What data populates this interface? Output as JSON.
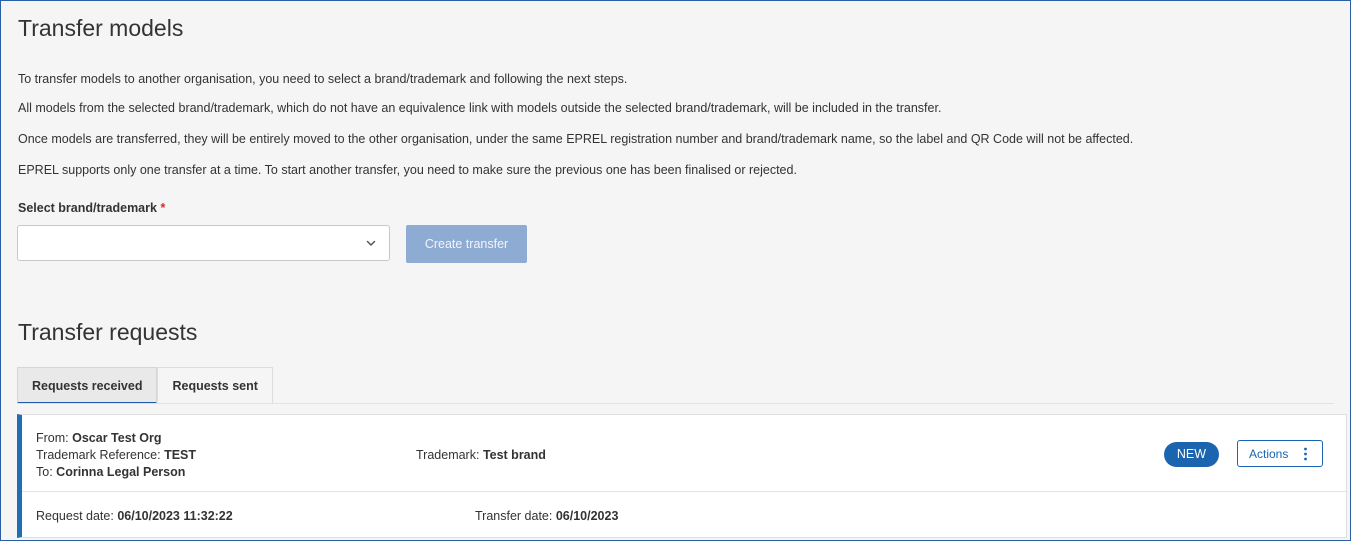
{
  "page": {
    "title": "Transfer models",
    "paragraphs": [
      "To transfer models to another organisation, you need to select a brand/trademark and following the next steps.",
      "All models from the selected brand/trademark, which do not have an equivalence link with models outside the selected brand/trademark, will be included in the transfer.",
      "Once models are transferred, they will be entirely moved to the other organisation, under the same EPREL registration number and brand/trademark name, so the label and QR Code will not be affected.",
      "EPREL supports only one transfer at a time. To start another transfer, you need to make sure the previous one has been finalised or rejected."
    ]
  },
  "form": {
    "select_label": "Select brand/trademark",
    "required_marker": "*",
    "select_value": "",
    "create_button": "Create transfer"
  },
  "requests": {
    "title": "Transfer requests",
    "tabs": [
      {
        "label": "Requests received",
        "active": true
      },
      {
        "label": "Requests sent",
        "active": false
      }
    ],
    "items": [
      {
        "from_label": "From:",
        "from_value": "Oscar Test Org",
        "trademark_ref_label": "Trademark Reference:",
        "trademark_ref_value": "TEST",
        "to_label": "To:",
        "to_value": "Corinna Legal Person",
        "trademark_label": "Trademark:",
        "trademark_value": "Test brand",
        "status": "NEW",
        "actions_label": "Actions",
        "request_date_label": "Request date:",
        "request_date_value": "06/10/2023 11:32:22",
        "transfer_date_label": "Transfer date:",
        "transfer_date_value": "06/10/2023"
      }
    ]
  },
  "colors": {
    "accent": "#1a64b0",
    "card_border": "#1e6fb4",
    "disabled_button": "#8eabd3",
    "required": "#d62b2b",
    "frame_border": "#2b5fa5"
  },
  "icons": {
    "select_caret": "chevron-down-icon",
    "actions_menu": "kebab-vertical-icon"
  }
}
